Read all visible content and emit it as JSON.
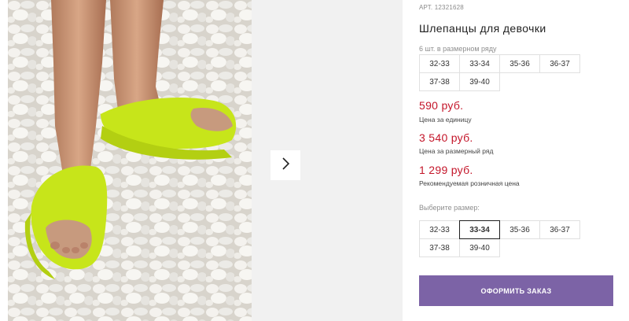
{
  "product": {
    "article": "АРТ. 12321628",
    "title": "Шлепанцы для девочки",
    "pack_note": "6 шт. в размерном ряду",
    "pack_sizes": [
      "32-33",
      "33-34",
      "35-36",
      "36-37",
      "37-38",
      "39-40"
    ]
  },
  "prices": [
    {
      "amount": "590 руб.",
      "caption": "Цена за единицу"
    },
    {
      "amount": "3 540 руб.",
      "caption": "Цена за размерный ряд"
    },
    {
      "amount": "1 299 руб.",
      "caption": "Рекомендуемая розничная цена"
    }
  ],
  "size_picker": {
    "label": "Выберите размер:",
    "options": [
      "32-33",
      "33-34",
      "35-36",
      "36-37",
      "37-38",
      "39-40"
    ],
    "selected": "33-34"
  },
  "actions": {
    "order_label": "ОФОРМИТЬ ЗАКАЗ"
  },
  "gallery": {
    "next_icon": "chevron-right-icon"
  },
  "colors": {
    "price_red": "#c4162a",
    "button_purple": "#7c63a6",
    "slide_lime": "#c7e51a"
  }
}
